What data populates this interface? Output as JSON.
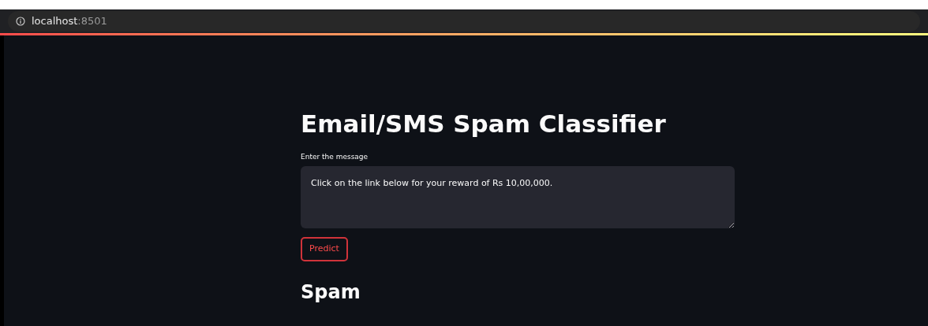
{
  "browser": {
    "url_host": "localhost",
    "url_port": ":8501"
  },
  "app": {
    "title": "Email/SMS Spam Classifier",
    "input_label": "Enter the message",
    "input_value": "Click on the link below for your reward of Rs 10,00,000.",
    "button": "Predict",
    "result": "Spam"
  }
}
